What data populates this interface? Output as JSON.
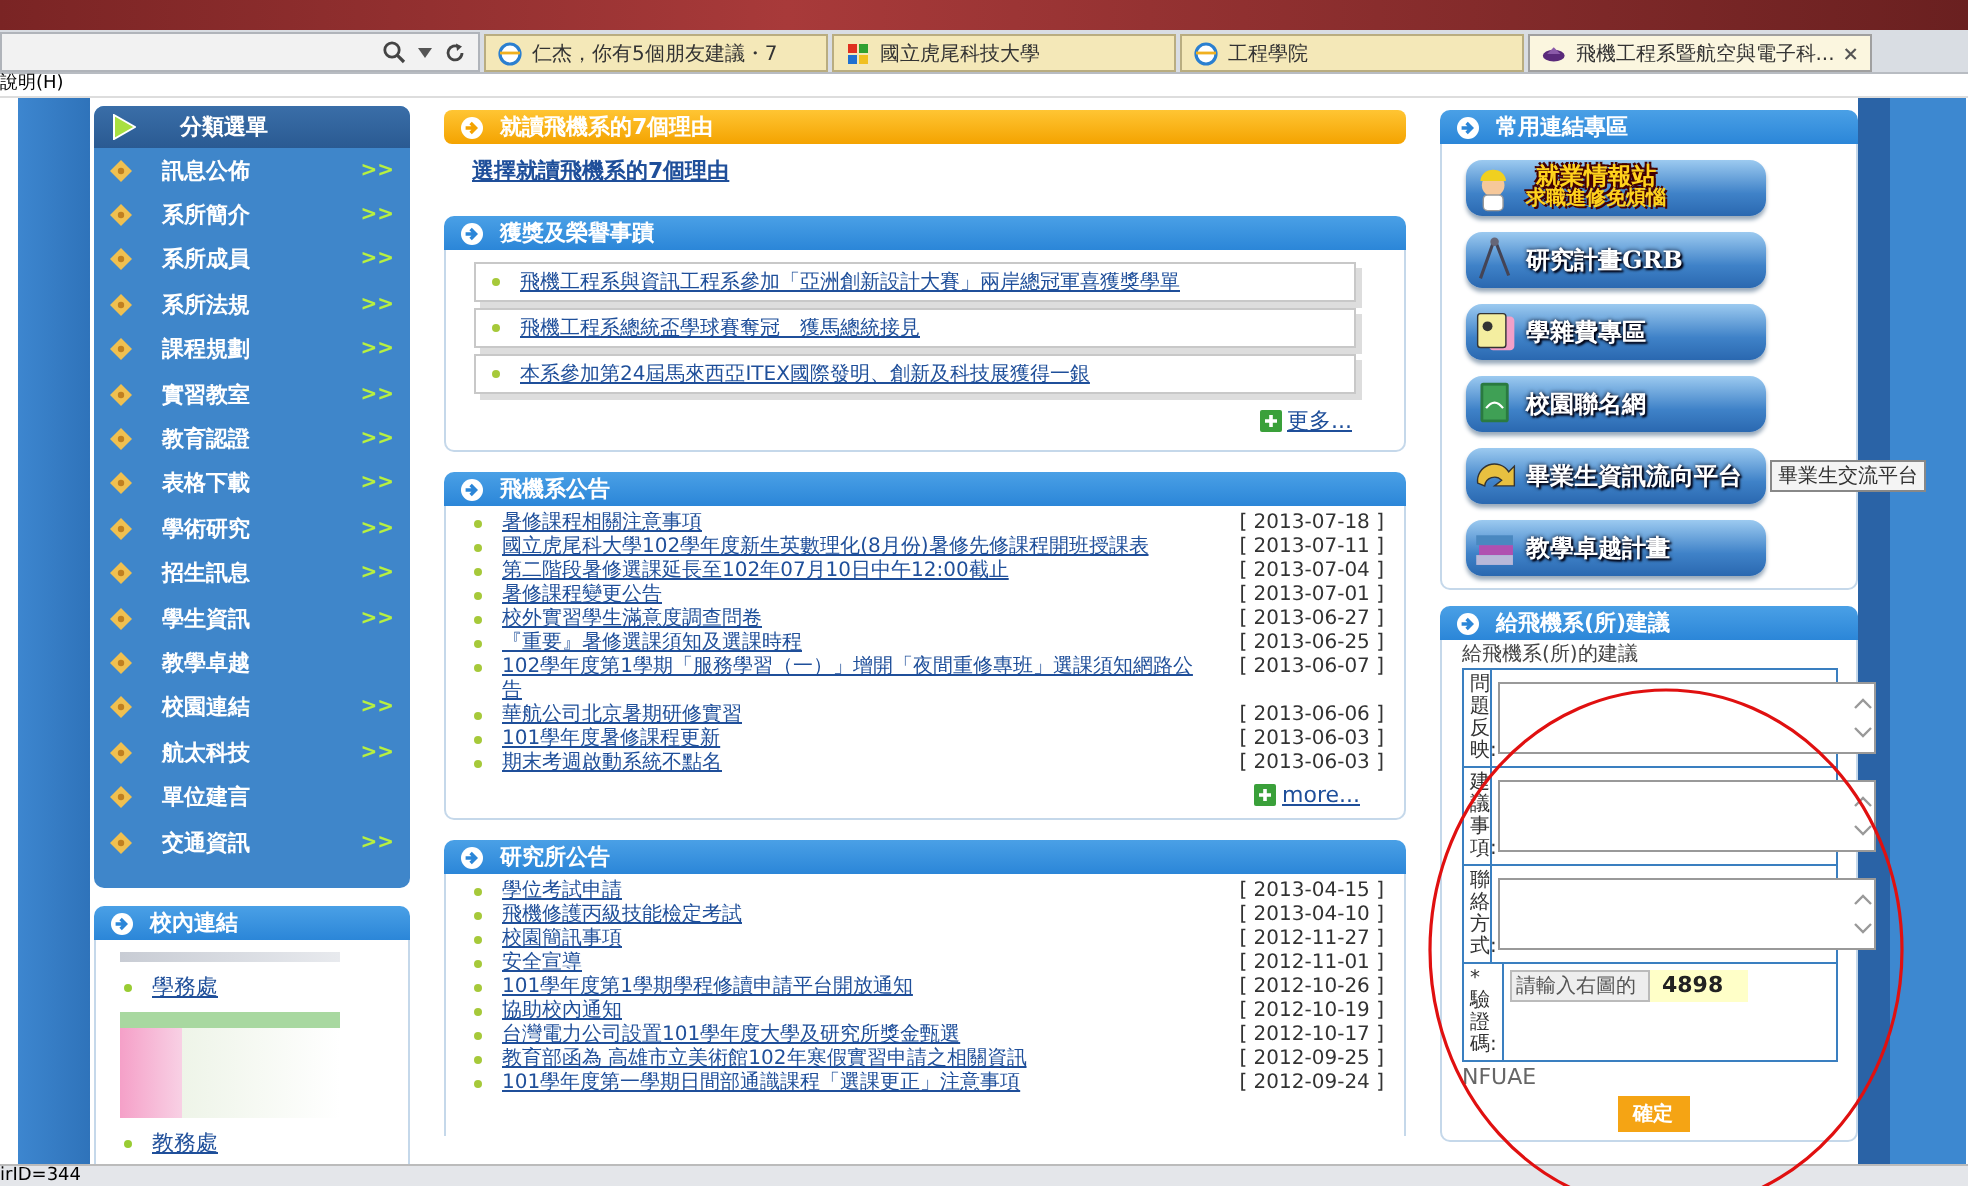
{
  "browser": {
    "tabs": [
      {
        "label": "仁杰，你有5個朋友建議・7",
        "selected": false
      },
      {
        "label": "國立虎尾科技大學",
        "selected": false
      },
      {
        "label": "工程學院",
        "selected": false
      },
      {
        "label": "飛機工程系暨航空與電子科...",
        "selected": true
      }
    ],
    "menu": [
      "說明(H)"
    ],
    "status": "irID=344"
  },
  "sidebar": {
    "title": "分類選單",
    "items": [
      {
        "label": "訊息公佈",
        "arrow": ">>"
      },
      {
        "label": "系所簡介",
        "arrow": ">>"
      },
      {
        "label": "系所成員",
        "arrow": ">>"
      },
      {
        "label": "系所法規",
        "arrow": ">>"
      },
      {
        "label": "課程規劃",
        "arrow": ">>"
      },
      {
        "label": "實習教室",
        "arrow": ">>"
      },
      {
        "label": "教育認證",
        "arrow": ">>"
      },
      {
        "label": "表格下載",
        "arrow": ">>"
      },
      {
        "label": "學術研究",
        "arrow": ">>"
      },
      {
        "label": "招生訊息",
        "arrow": ">>"
      },
      {
        "label": "學生資訊",
        "arrow": ">>"
      },
      {
        "label": "教學卓越"
      },
      {
        "label": "校園連結",
        "arrow": ">>"
      },
      {
        "label": "航太科技",
        "arrow": ">>"
      },
      {
        "label": "單位建言"
      },
      {
        "label": "交通資訊",
        "arrow": ">>"
      }
    ]
  },
  "campus_links": {
    "title": "校內連結",
    "links": [
      "學務處",
      "教務處"
    ]
  },
  "panels": [
    {
      "kind": "featured",
      "title": "就讀飛機系的7個理由",
      "link": "選擇就讀飛機系的7個理由"
    },
    {
      "kind": "boxed",
      "title": "獲獎及榮譽事蹟",
      "items": [
        "飛機工程系與資訊工程系參加「亞洲創新設計大賽」兩岸總冠軍喜獲獎學單",
        "飛機工程系總統盃學球賽奪冠　獲馬總統接見",
        "本系參加第24屆馬來西亞ITEX國際發明、創新及科技展獲得一銀"
      ],
      "more": "更多..."
    },
    {
      "kind": "dated",
      "title": "飛機系公告",
      "items": [
        {
          "title": "暑修課程相關注意事項",
          "date": "[ 2013-07-18 ]"
        },
        {
          "title": "國立虎尾科大學102學年度新生英數理化(8月份)暑修先修課程開班授課表",
          "date": "[ 2013-07-11 ]"
        },
        {
          "title": "第二階段暑修選課延長至102年07月10日中午12:00截止",
          "date": "[ 2013-07-04 ]"
        },
        {
          "title": "暑修課程變更公告",
          "date": "[ 2013-07-01 ]"
        },
        {
          "title": "校外實習學生滿意度調查問卷",
          "date": "[ 2013-06-27 ]"
        },
        {
          "title": "『重要』暑修選課須知及選課時程",
          "date": "[ 2013-06-25 ]"
        },
        {
          "title": "102學年度第1學期「服務學習（一）」增開「夜間重修專班」選課須知網路公告",
          "date": "[ 2013-06-07 ]"
        },
        {
          "title": "華航公司北京暑期研修實習",
          "date": "[ 2013-06-06 ]"
        },
        {
          "title": "101學年度暑修課程更新",
          "date": "[ 2013-06-03 ]"
        },
        {
          "title": "期末考週啟動系統不點名",
          "date": "[ 2013-06-03 ]"
        }
      ],
      "more": "more..."
    },
    {
      "kind": "dated",
      "title": "研究所公告",
      "items": [
        {
          "title": "學位考試申請",
          "date": "[ 2013-04-15 ]"
        },
        {
          "title": "飛機修護丙級技能檢定考試",
          "date": "[ 2013-04-10 ]"
        },
        {
          "title": "校園簡訊事項",
          "date": "[ 2012-11-27 ]"
        },
        {
          "title": "安全宣導",
          "date": "[ 2012-11-01 ]"
        },
        {
          "title": "101學年度第1學期學程修讀申請平台開放通知",
          "date": "[ 2012-10-26 ]"
        },
        {
          "title": "協助校內通知",
          "date": "[ 2012-10-19 ]"
        },
        {
          "title": "台灣電力公司設置101學年度大學及研究所獎金甄選",
          "date": "[ 2012-10-17 ]"
        },
        {
          "title": "教育部函為 高雄市立美術館102年寒假實習申請之相關資訊",
          "date": "[ 2012-09-25 ]"
        },
        {
          "title": "101學年度第一學期日間部通識課程「選課更正」注意事項",
          "date": "[ 2012-09-24 ]"
        }
      ]
    }
  ],
  "quick_links": {
    "title": "常用連結專區",
    "banners": [
      {
        "kind": "person",
        "text": "就業情報站",
        "subtext": "求職進修免煩惱"
      },
      {
        "kind": "compass",
        "text": "研究計畫GRB"
      },
      {
        "kind": "card",
        "text": "學雜費專區"
      },
      {
        "kind": "book",
        "text": "校園聯名網"
      },
      {
        "kind": "arrow",
        "text": "畢業生資訊流向平台"
      },
      {
        "kind": "books",
        "text": "教學卓越計畫"
      }
    ],
    "tooltip": "畢業生交流平台"
  },
  "feedback": {
    "title": "給飛機系(所)建議",
    "caption": "給飛機系(所)的建議",
    "fields": [
      "問題反映:",
      "建議事項:",
      "聯絡方式:"
    ],
    "captcha": {
      "label": "*驗證碼:",
      "placeholder": "請輸入右圖的",
      "code": "4898"
    },
    "note": "NFUAE",
    "submit": "確定"
  }
}
